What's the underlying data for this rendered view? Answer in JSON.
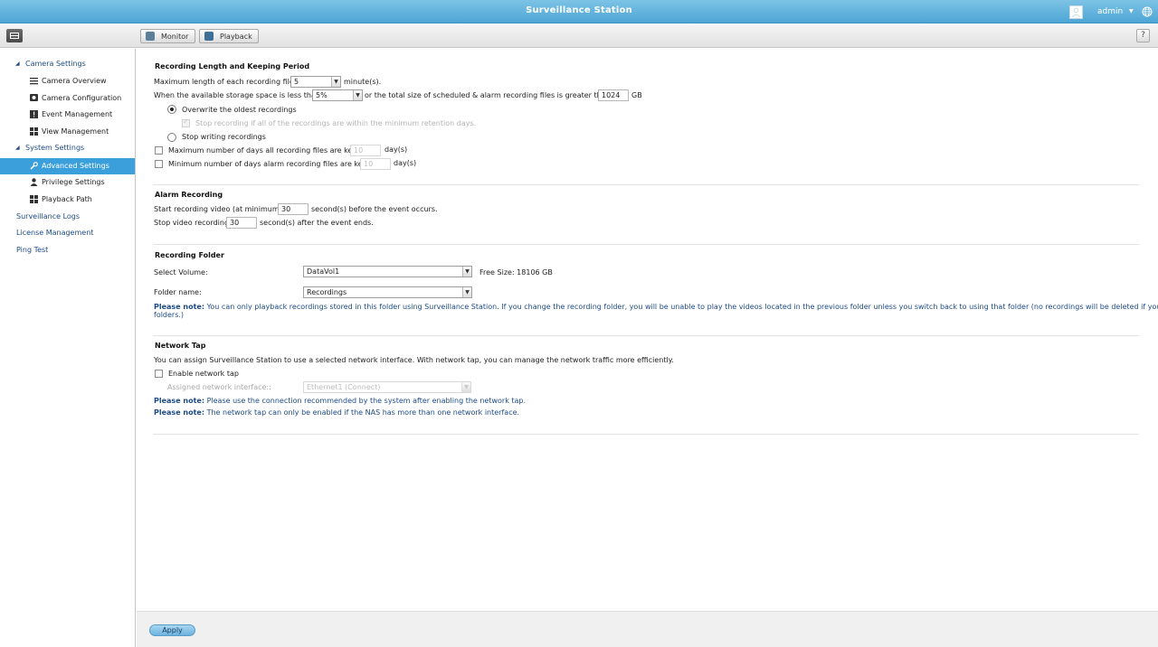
{
  "app": {
    "title": "Surveillance Station",
    "user": "admin"
  },
  "toolbar": {
    "monitor_label": "Monitor",
    "playback_label": "Playback",
    "help_label": "?"
  },
  "sidebar": {
    "camera_settings": "Camera Settings",
    "camera_overview": "Camera Overview",
    "camera_configuration": "Camera Configuration",
    "event_management": "Event Management",
    "view_management": "View Management",
    "system_settings": "System Settings",
    "advanced_settings": "Advanced Settings",
    "privilege_settings": "Privilege Settings",
    "playback_path": "Playback Path",
    "surveillance_logs": "Surveillance Logs",
    "license_management": "License Management",
    "ping_test": "Ping Test"
  },
  "recording_length": {
    "heading": "Recording Length and Keeping Period",
    "max_length_label": "Maximum length of each recording file:",
    "max_length_value": "5",
    "max_length_unit": "minute(s).",
    "storage_label": "When the available storage space is less than",
    "storage_value": "5%",
    "total_size_label": "or the total size of scheduled & alarm recording files is greater than",
    "total_size_value": "1024",
    "total_size_unit": "GB",
    "overwrite_label": "Overwrite the oldest recordings",
    "stop_if_min_label": "Stop recording if all of the recordings are within the minimum retention days.",
    "stop_writing_label": "Stop writing recordings",
    "max_days_label": "Maximum number of days all recording files are kept",
    "max_days_value": "10",
    "max_days_unit": "day(s)",
    "min_days_label": "Minimum number of days alarm recording files are kept",
    "min_days_value": "10",
    "min_days_unit": "day(s)"
  },
  "alarm_recording": {
    "heading": "Alarm Recording",
    "start_label": "Start recording video (at minimum)",
    "start_value": "30",
    "start_suffix": "second(s) before the event occurs.",
    "stop_label": "Stop video recording",
    "stop_value": "30",
    "stop_suffix": "second(s) after the event ends."
  },
  "recording_folder": {
    "heading": "Recording Folder",
    "volume_label": "Select Volume:",
    "volume_value": "DataVol1",
    "free_size": "Free Size: 18106 GB",
    "folder_label": "Folder name:",
    "folder_value": "Recordings",
    "note_prefix": "Please note:",
    "note_text": " You can only playback recordings stored in this folder using Surveillance Station. If you change the recording folder, you will be unable to play the videos located in the previous folder unless you switch back to using that folder (no recordings will be deleted if you switch",
    "note_text2": "folders.)"
  },
  "network_tap": {
    "heading": "Network Tap",
    "description": "You can assign Surveillance Station to use a selected network interface. With network tap, you can manage the network traffic more efficiently.",
    "enable_label": "Enable network tap",
    "interface_label": "Assigned network interface::",
    "interface_value": "Ethernet1 (Connect)",
    "note1_prefix": "Please note:",
    "note1_text": " Please use the connection recommended by the system after enabling the network tap.",
    "note2_prefix": "Please note:",
    "note2_text": " The network tap can only be enabled if the NAS has more than one network interface."
  },
  "footer": {
    "apply_label": "Apply"
  }
}
